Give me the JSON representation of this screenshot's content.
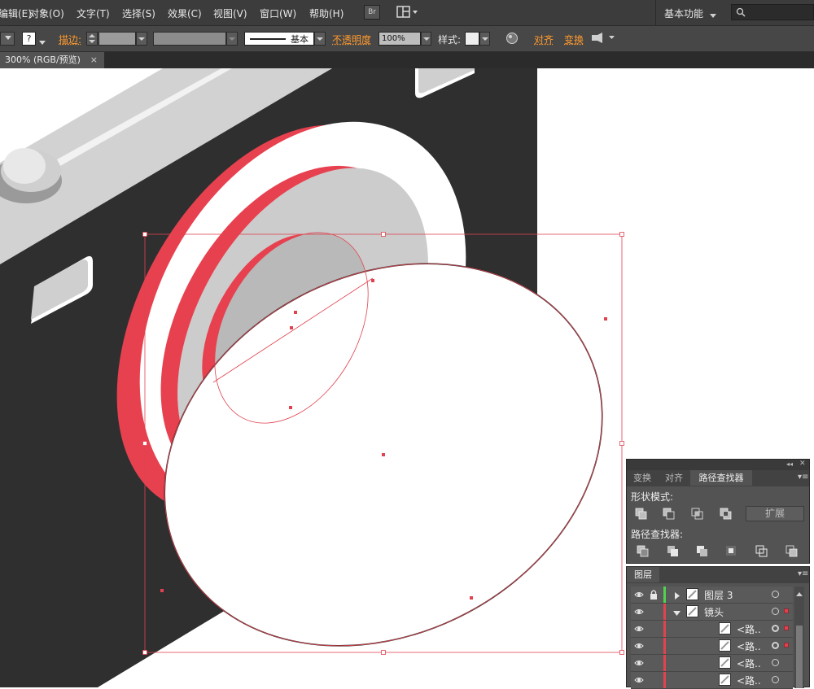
{
  "menubar": {
    "items": [
      "编辑(E)",
      "对象(O)",
      "文字(T)",
      "选择(S)",
      "效果(C)",
      "视图(V)",
      "窗口(W)",
      "帮助(H)"
    ],
    "br_label": "Br",
    "workspace": "基本功能",
    "search_placeholder": ""
  },
  "control_bar": {
    "stroke_label": "描边:",
    "stroke_style": "基本",
    "opacity_label": "不透明度",
    "opacity_value": "100%",
    "style_label": "样式:",
    "align_label": "对齐",
    "transform_label": "变换",
    "question_mark": "?"
  },
  "document": {
    "tab_title": "300% (RGB/预览)",
    "close": "×"
  },
  "pathfinder_panel": {
    "tabs": [
      "变换",
      "对齐",
      "路径查找器"
    ],
    "active_tab": 2,
    "shape_modes_title": "形状模式:",
    "expand_label": "扩展",
    "pathfinders_title": "路径查找器:"
  },
  "layers_panel": {
    "title": "图层",
    "rows": [
      {
        "name": "图层 3",
        "level": 0,
        "expanded": false,
        "locked": true,
        "color": "#4fd24f"
      },
      {
        "name": "镜头",
        "level": 0,
        "expanded": true,
        "locked": false,
        "color": "#e0434f"
      },
      {
        "name": "<路..",
        "level": 1
      },
      {
        "name": "<路..",
        "level": 1
      },
      {
        "name": "<路..",
        "level": 1
      },
      {
        "name": "<路..",
        "level": 1
      }
    ]
  },
  "colors": {
    "camera_body": "#2f2f2f",
    "camera_top": "#d2d2d2",
    "lens_red": "#e7414f",
    "lens_ring": "#ffffff",
    "lens_inner": "#cccccc",
    "lens_glass": "#b9b9b9",
    "selection": "#e0434f",
    "ui_dark": "#3c3c3c",
    "ui_panel": "#535353",
    "accent_orange": "#ff9a2e"
  }
}
